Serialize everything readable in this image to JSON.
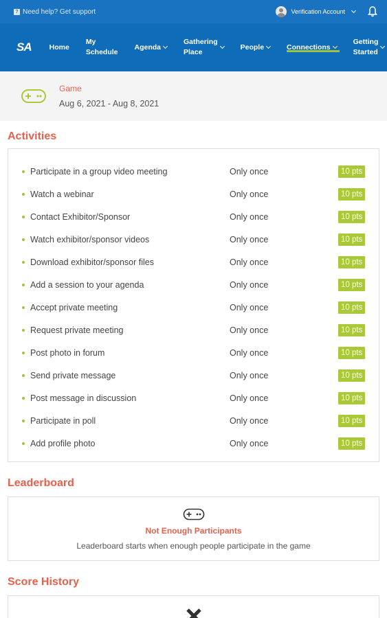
{
  "topbar": {
    "help_label": "Need help? Get support",
    "account_name": "Verification Account"
  },
  "nav": {
    "logo": "SA",
    "items": [
      {
        "label": "Home",
        "dropdown": false
      },
      {
        "label": "My\nSchedule",
        "dropdown": false
      },
      {
        "label": "Agenda",
        "dropdown": true
      },
      {
        "label": "Gathering\nPlace",
        "dropdown": true
      },
      {
        "label": "People",
        "dropdown": true
      },
      {
        "label": "Connections",
        "dropdown": true,
        "active": true
      },
      {
        "label": "Getting\nStarted",
        "dropdown": true
      }
    ]
  },
  "game": {
    "type_label": "Game",
    "dates": "Aug 6, 2021 - Aug 8, 2021"
  },
  "activities": {
    "title": "Activities",
    "items": [
      {
        "name": "Participate in a group video meeting",
        "frequency": "Only once",
        "points": "10 pts"
      },
      {
        "name": "Watch a webinar",
        "frequency": "Only once",
        "points": "10 pts"
      },
      {
        "name": "Contact Exhibitor/Sponsor",
        "frequency": "Only once",
        "points": "10 pts"
      },
      {
        "name": "Watch exhibitor/sponsor videos",
        "frequency": "Only once",
        "points": "10 pts"
      },
      {
        "name": "Download exhibitor/sponsor files",
        "frequency": "Only once",
        "points": "10 pts"
      },
      {
        "name": "Add a session to your agenda",
        "frequency": "Only once",
        "points": "10 pts"
      },
      {
        "name": "Accept private meeting",
        "frequency": "Only once",
        "points": "10 pts"
      },
      {
        "name": "Request private meeting",
        "frequency": "Only once",
        "points": "10 pts"
      },
      {
        "name": "Post photo in forum",
        "frequency": "Only once",
        "points": "10 pts"
      },
      {
        "name": "Send private message",
        "frequency": "Only once",
        "points": "10 pts"
      },
      {
        "name": "Post message in discussion",
        "frequency": "Only once",
        "points": "10 pts"
      },
      {
        "name": "Participate in poll",
        "frequency": "Only once",
        "points": "10 pts"
      },
      {
        "name": "Add profile photo",
        "frequency": "Only once",
        "points": "10 pts"
      }
    ]
  },
  "leaderboard": {
    "title": "Leaderboard",
    "empty_title": "Not Enough Participants",
    "empty_message": "Leaderboard starts when enough people participate in the game"
  },
  "score_history": {
    "title": "Score History"
  },
  "colors": {
    "topbar_bg": "#1a73c0",
    "nav_bg": "#0f6cb8",
    "accent_red": "#e8604c",
    "accent_green": "#a9c938"
  }
}
